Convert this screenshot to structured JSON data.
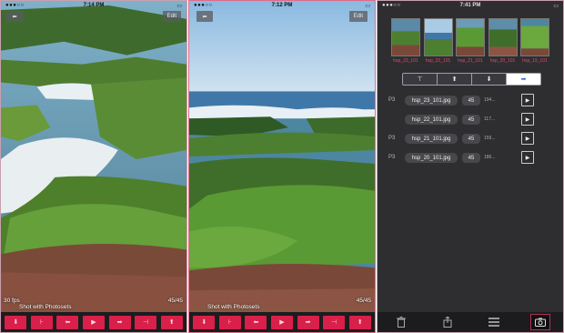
{
  "screen1": {
    "status_time": "7:14 PM",
    "carrier": "●●●○○",
    "back_label": "⬅",
    "edit_label": "Edit",
    "fps": "30 fps",
    "caption": "Shot with Photosets",
    "counter": "45/45",
    "toolbar": [
      "⬇",
      "⊦",
      "⬅",
      "▶",
      "➡",
      "⊣",
      "⬆"
    ]
  },
  "screen2": {
    "status_time": "7:12 PM",
    "carrier": "●●●○○",
    "back_label": "⬅",
    "edit_label": "Edit",
    "caption": "Shot with Photosets",
    "counter": "45/45",
    "toolbar": [
      "⬇",
      "⊦",
      "⬅",
      "▶",
      "➡",
      "⊣",
      "⬆"
    ]
  },
  "screen3": {
    "status_time": "7:41 PM",
    "carrier": "●●●○○",
    "thumbs": [
      "hsp_23_101",
      "hsp_22_101",
      "hsp_21_101",
      "hsp_20_101",
      "hsp_19_101"
    ],
    "segments": [
      "⊤",
      "⬆",
      "⬇",
      "➡"
    ],
    "active_segment": 3,
    "rows": [
      {
        "prefix": "P3",
        "file": "hsp_23_101.jpg",
        "num": "45",
        "extra": "194..."
      },
      {
        "prefix": "",
        "file": "hsp_22_101.jpg",
        "num": "45",
        "extra": "117..."
      },
      {
        "prefix": "P3",
        "file": "hsp_21_101.jpg",
        "num": "45",
        "extra": "159..."
      },
      {
        "prefix": "P3",
        "file": "hsp_20_101.jpg",
        "num": "45",
        "extra": "186..."
      }
    ],
    "play_label": "▶",
    "bottom_icons": [
      "trash-icon",
      "share-icon",
      "list-icon",
      "camera-icon"
    ]
  },
  "colors": {
    "accent": "#d8204a",
    "thumb_label": "#e04a6e",
    "segment_active": "#2f6fe0"
  }
}
